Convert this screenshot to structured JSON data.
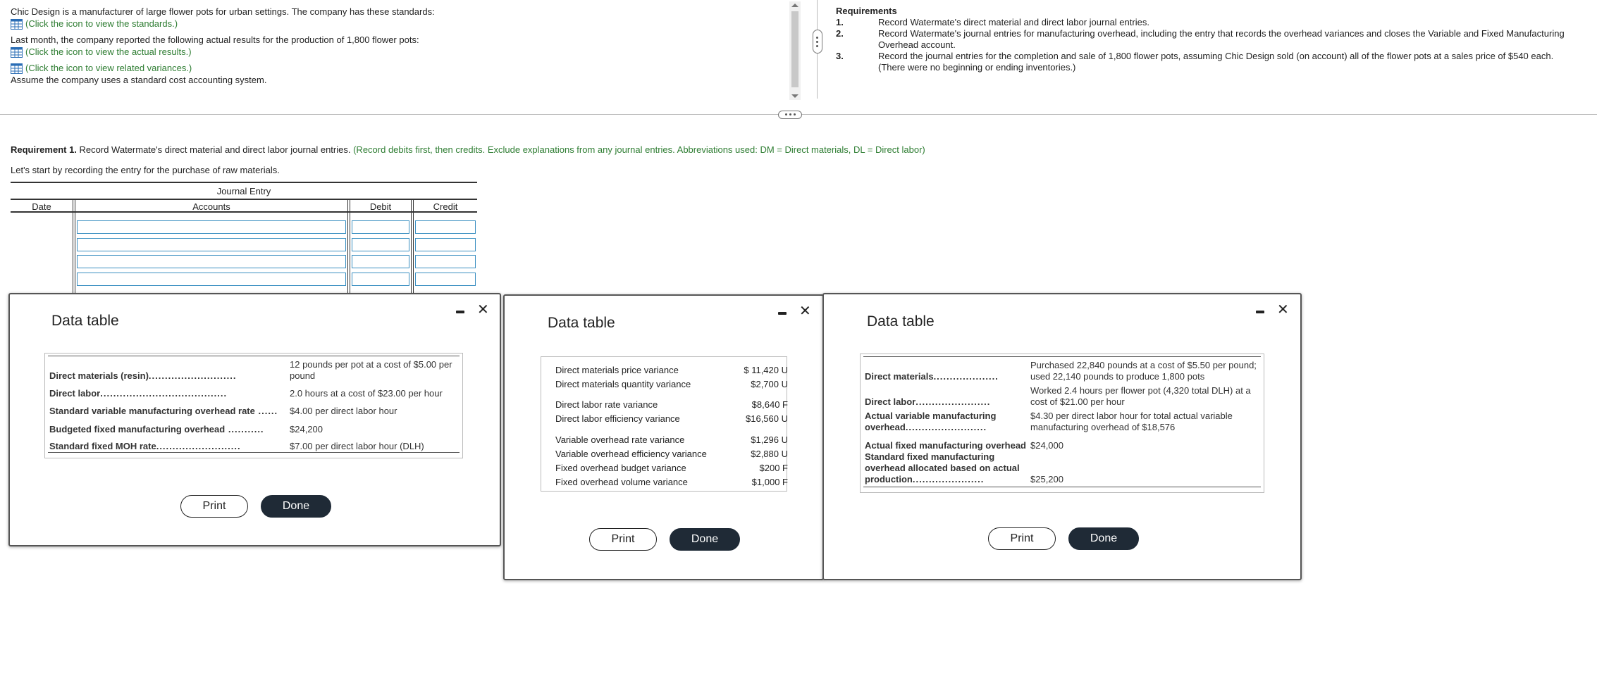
{
  "intro": {
    "line1": "Chic Design is a manufacturer of large flower pots for urban settings. The company has these standards:",
    "link1": "(Click the icon to view the standards.)",
    "line2": "Last month, the company reported the following actual results for the production of 1,800 flower pots:",
    "link2": "(Click the icon to view the actual results.)",
    "link3": "(Click the icon to view related variances.)",
    "line3": "Assume the company uses a standard cost accounting system."
  },
  "requirements": {
    "heading": "Requirements",
    "items": [
      {
        "num": "1.",
        "text": "Record Watermate's direct material and direct labor journal entries."
      },
      {
        "num": "2.",
        "text": "Record Watermate's journal entries for manufacturing overhead, including the entry that records the overhead variances and closes the Variable and Fixed Manufacturing Overhead account."
      },
      {
        "num": "3.",
        "text": "Record the journal entries for the completion and sale of 1,800 flower pots, assuming Chic Design sold (on account) all of the flower pots at a sales price of $540 each. (There were no beginning or ending inventories.)"
      }
    ]
  },
  "req1": {
    "label": "Requirement 1.",
    "text": " Record Watermate's direct material and direct labor journal entries.",
    "instructions": " (Record debits first, then credits. Exclude explanations from any journal entries. Abbreviations used: DM = Direct materials, DL = Direct labor)",
    "start": "Let's start by recording the entry for the purchase of raw materials."
  },
  "journal": {
    "title": "Journal Entry",
    "col_date": "Date",
    "col_accounts": "Accounts",
    "col_debit": "Debit",
    "col_credit": "Credit",
    "rows": [
      {
        "account": "",
        "debit": "",
        "credit": ""
      },
      {
        "account": "",
        "debit": "",
        "credit": ""
      },
      {
        "account": "",
        "debit": "",
        "credit": ""
      },
      {
        "account": "",
        "debit": "",
        "credit": ""
      }
    ]
  },
  "standards_dialog": {
    "title": "Data table",
    "rows": [
      {
        "label": "Direct materials (resin)",
        "value1": "12 pounds per pot at a cost of $5.00 per",
        "value2": "pound"
      },
      {
        "label": "Direct labor",
        "value1": "2.0 hours at a cost of $23.00 per hour"
      },
      {
        "label": "Standard variable manufacturing overhead rate",
        "value1": "$4.00 per direct labor hour"
      },
      {
        "label": "Budgeted fixed manufacturing overhead",
        "value1": "$24,200"
      },
      {
        "label": "Standard fixed MOH rate",
        "value1": "$7.00 per direct labor hour (DLH)"
      }
    ],
    "print": "Print",
    "done": "Done"
  },
  "variances_dialog": {
    "title": "Data table",
    "rows": [
      {
        "label": "Direct materials price variance",
        "value": "$ 11,420 U"
      },
      {
        "label": "Direct materials quantity variance",
        "value": "$2,700 U"
      },
      {
        "label": "Direct labor rate variance",
        "value": "$8,640 F"
      },
      {
        "label": "Direct labor efficiency variance",
        "value": "$16,560 U"
      },
      {
        "label": "Variable overhead rate variance",
        "value": "$1,296 U"
      },
      {
        "label": "Variable overhead efficiency variance",
        "value": "$2,880 U"
      },
      {
        "label": "Fixed overhead budget variance",
        "value": "$200 F"
      },
      {
        "label": "Fixed overhead volume variance",
        "value": "$1,000 F"
      }
    ],
    "print": "Print",
    "done": "Done"
  },
  "actuals_dialog": {
    "title": "Data table",
    "dm_label": "Direct materials",
    "dm_v1": "Purchased 22,840 pounds at a cost of $5.50 per pound;",
    "dm_v2": "used 22,140 pounds to produce 1,800 pots",
    "dl_label": "Direct labor",
    "dl_v1": "Worked 2.4 hours per flower pot (4,320 total DLH) at a",
    "dl_v2": "cost of $21.00 per hour",
    "avo_label1": "Actual variable manufacturing",
    "avo_label2": "overhead",
    "avo_v1": "$4.30 per direct labor hour for total actual variable",
    "avo_v2": "manufacturing overhead of $18,576",
    "afo_label": "Actual fixed manufacturing overhead",
    "afo_v": "$24,000",
    "sfo_label1": "Standard fixed manufacturing",
    "sfo_label2": "overhead allocated based on actual",
    "sfo_label3": "production",
    "sfo_v": "$25,200",
    "print": "Print",
    "done": "Done"
  },
  "colors": {
    "green": "#2e7d32",
    "input_border": "#3a8fc1",
    "done_bg": "#1f2a36"
  }
}
